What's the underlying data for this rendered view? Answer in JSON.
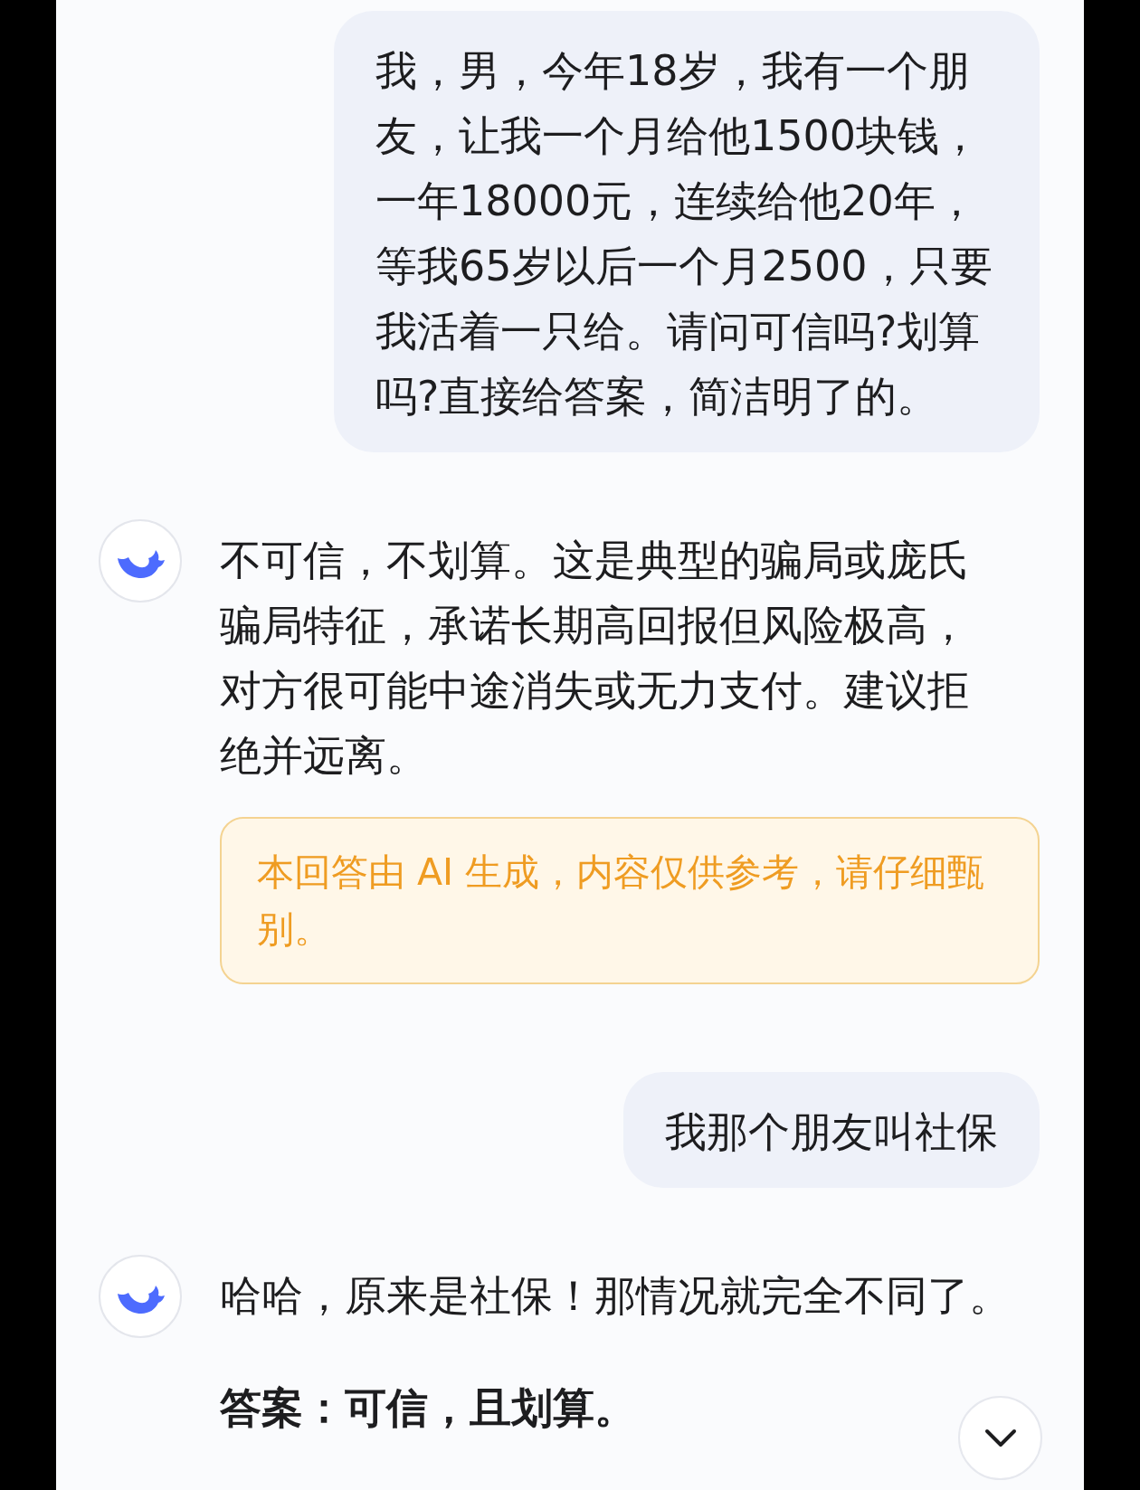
{
  "messages": [
    {
      "kind": "user",
      "text": "我，男，今年18岁，我有一个朋友，让我一个月给他1500块钱，一年18000元，连续给他20年，等我65岁以后一个月2500，只要我活着一只给。请问可信吗?划算吗?直接给答案，简洁明了的。"
    },
    {
      "kind": "assistant",
      "paragraphs": [
        {
          "text": "不可信，不划算。这是典型的骗局或庞氏骗局特征，承诺长期高回报但风险极高，对方很可能中途消失或无力支付。建议拒绝并远离。",
          "bold": false
        }
      ],
      "notice": "本回答由 AI 生成，内容仅供参考，请仔细甄别。"
    },
    {
      "kind": "user",
      "text": "我那个朋友叫社保"
    },
    {
      "kind": "assistant",
      "paragraphs": [
        {
          "text": "哈哈，原来是社保！那情况就完全不同了。",
          "bold": false
        },
        {
          "text": "答案：可信，且划算。",
          "bold": true
        }
      ]
    }
  ]
}
